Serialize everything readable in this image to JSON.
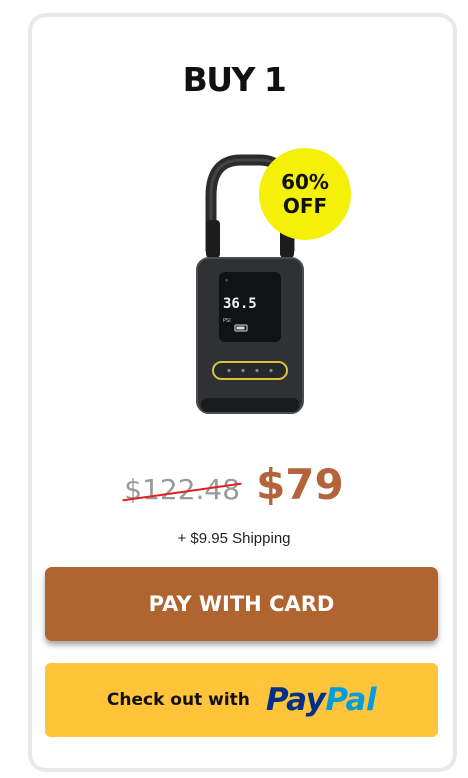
{
  "offer": {
    "title": "BUY 1",
    "badge_line1": "60%",
    "badge_line2": "OFF",
    "screen_reading": "36.5",
    "screen_unit": "PSI",
    "old_price": "$122.48",
    "new_price": "$79",
    "shipping": "+ $9.95 Shipping"
  },
  "actions": {
    "pay_card_label": "PAY WITH CARD",
    "paypal_prefix": "Check out with",
    "paypal_logo_part1": "Pay",
    "paypal_logo_part2": "Pal"
  },
  "colors": {
    "card_button": "#b0642f",
    "price": "#b3643a",
    "badge": "#f4f007",
    "paypal_button": "#ffc439",
    "paypal_dark": "#003087",
    "paypal_light": "#009cde",
    "strike": "#e0201f"
  },
  "icons": {
    "product": "tire-inflator-image",
    "paypal": "paypal-logo"
  }
}
